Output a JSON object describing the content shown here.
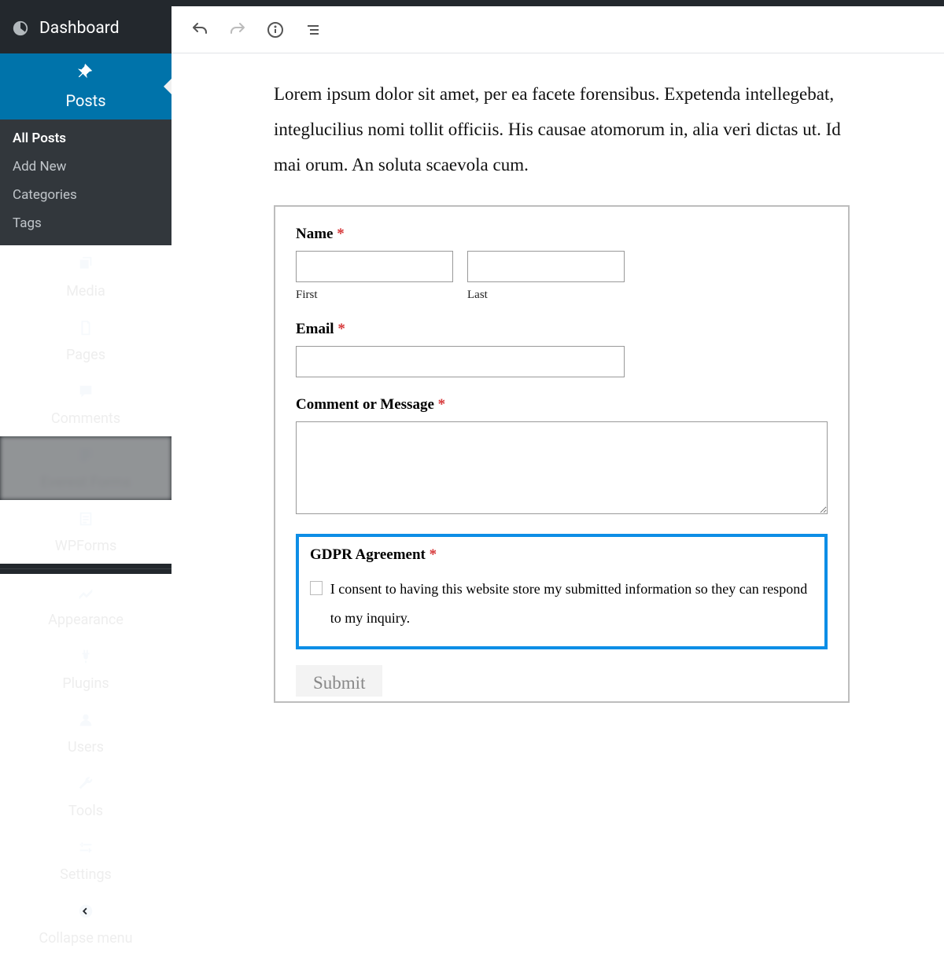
{
  "sidebar": {
    "dashboard": "Dashboard",
    "posts": "Posts",
    "submenu": [
      "All Posts",
      "Add New",
      "Categories",
      "Tags"
    ],
    "media": "Media",
    "pages": "Pages",
    "comments": "Comments",
    "blurred": "Everest Forms",
    "wpforms": "WPForms",
    "appearance": "Appearance",
    "plugins": "Plugins",
    "users": "Users",
    "tools": "Tools",
    "settings": "Settings",
    "collapse": "Collapse menu"
  },
  "editor": {
    "paragraph": "Lorem ipsum dolor sit amet, per ea facete forensibus. Expetenda intellegebat, integlucilius nomi tollit officiis. His causae atomorum in, alia veri dictas ut. Id mai orum. An soluta scaevola cum."
  },
  "form": {
    "name_label": "Name",
    "first_label": "First",
    "last_label": "Last",
    "email_label": "Email",
    "message_label": "Comment or Message",
    "gdpr_title": "GDPR Agreement",
    "gdpr_text": "I consent to having this website store my submitted information so they can respond to my inquiry.",
    "submit": "Submit",
    "required": "*"
  }
}
